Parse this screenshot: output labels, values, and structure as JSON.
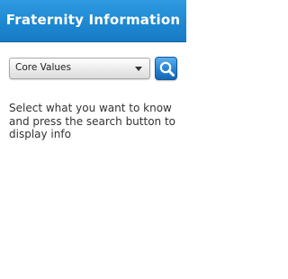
{
  "header": {
    "title": "Fraternity Information",
    "background_color": "#1f88d2"
  },
  "category_select": {
    "selected_value": "Core Values"
  },
  "search_button": {
    "icon": "magnifier-icon"
  },
  "main": {
    "instruction_text": "Select what you want to know and press the search button to display info"
  }
}
